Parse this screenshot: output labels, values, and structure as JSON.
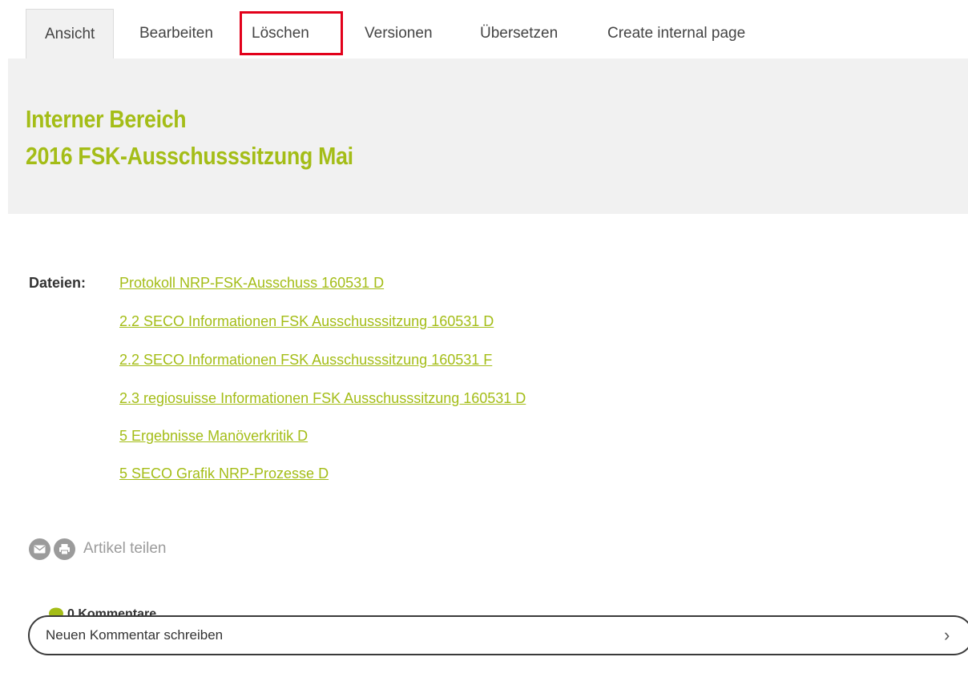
{
  "tabs": [
    {
      "label": "Ansicht"
    },
    {
      "label": "Bearbeiten"
    },
    {
      "label": "Löschen"
    },
    {
      "label": "Versionen"
    },
    {
      "label": "Übersetzen"
    },
    {
      "label": "Create internal page"
    }
  ],
  "header": {
    "line1": "Interner Bereich",
    "line2": "2016 FSK-Ausschusssitzung Mai"
  },
  "files": {
    "label": "Dateien:",
    "links": [
      "Protokoll NRP-FSK-Ausschuss 160531 D",
      "2.2 SECO Informationen FSK Ausschusssitzung 160531 D",
      "2.2 SECO Informationen FSK Ausschusssitzung 160531 F",
      "2.3 regiosuisse Informationen FSK Ausschusssitzung 160531 D",
      "5 Ergebnisse Manöverkritik D",
      "5 SECO Grafik NRP-Prozesse D"
    ]
  },
  "share": {
    "label": "Artikel teilen",
    "icons": [
      "mail-icon",
      "print-icon"
    ]
  },
  "comments": {
    "count_label": "0 Kommentare",
    "input_label": "Neuen Kommentar schreiben",
    "chevron": "›"
  },
  "colors": {
    "accent": "#a4bd17",
    "highlight": "#e2001a",
    "band": "#f1f1f1"
  }
}
